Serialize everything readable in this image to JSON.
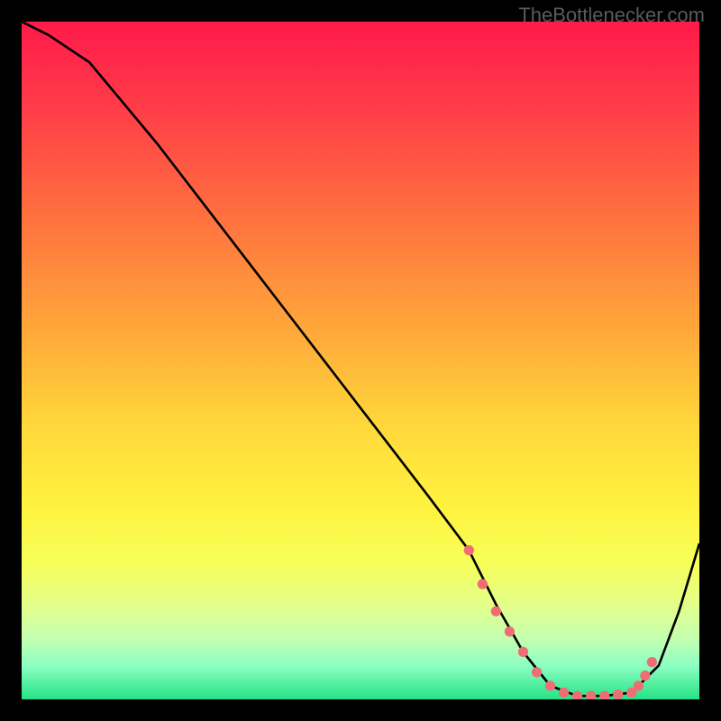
{
  "watermark": "TheBottlenecker.com",
  "colors": {
    "bg": "#000000",
    "curve": "#000000",
    "dot": "#ef6e74",
    "watermark": "#5a5a5a"
  },
  "chart_data": {
    "type": "line",
    "title": "",
    "xlabel": "",
    "ylabel": "",
    "xlim": [
      0,
      100
    ],
    "ylim": [
      0,
      100
    ],
    "gradient_stops": [
      {
        "offset": 0,
        "color": "#ff1a4b"
      },
      {
        "offset": 12,
        "color": "#ff3a48"
      },
      {
        "offset": 28,
        "color": "#ff6e3f"
      },
      {
        "offset": 45,
        "color": "#ffa63a"
      },
      {
        "offset": 60,
        "color": "#ffd93a"
      },
      {
        "offset": 72,
        "color": "#fff33f"
      },
      {
        "offset": 80,
        "color": "#f6ff5a"
      },
      {
        "offset": 86,
        "color": "#e4ff8a"
      },
      {
        "offset": 91,
        "color": "#c4ffb0"
      },
      {
        "offset": 95,
        "color": "#8dffc2"
      },
      {
        "offset": 100,
        "color": "#25e286"
      }
    ],
    "series": [
      {
        "name": "bottleneck-curve",
        "x": [
          0,
          4,
          10,
          20,
          30,
          40,
          50,
          60,
          66,
          70,
          74,
          78,
          82,
          86,
          90,
          94,
          97,
          100
        ],
        "values": [
          100,
          98,
          94,
          82,
          69,
          56,
          43,
          30,
          22,
          14,
          7,
          2,
          0.5,
          0.5,
          1,
          5,
          13,
          23
        ]
      }
    ],
    "dots": {
      "name": "highlight-dots",
      "x": [
        66,
        68,
        70,
        72,
        74,
        76,
        78,
        80,
        82,
        84,
        86,
        88,
        90,
        91,
        92,
        93
      ],
      "values": [
        22,
        17,
        13,
        10,
        7,
        4,
        2,
        1,
        0.5,
        0.5,
        0.5,
        0.7,
        1,
        2,
        3.5,
        5.5
      ]
    }
  }
}
